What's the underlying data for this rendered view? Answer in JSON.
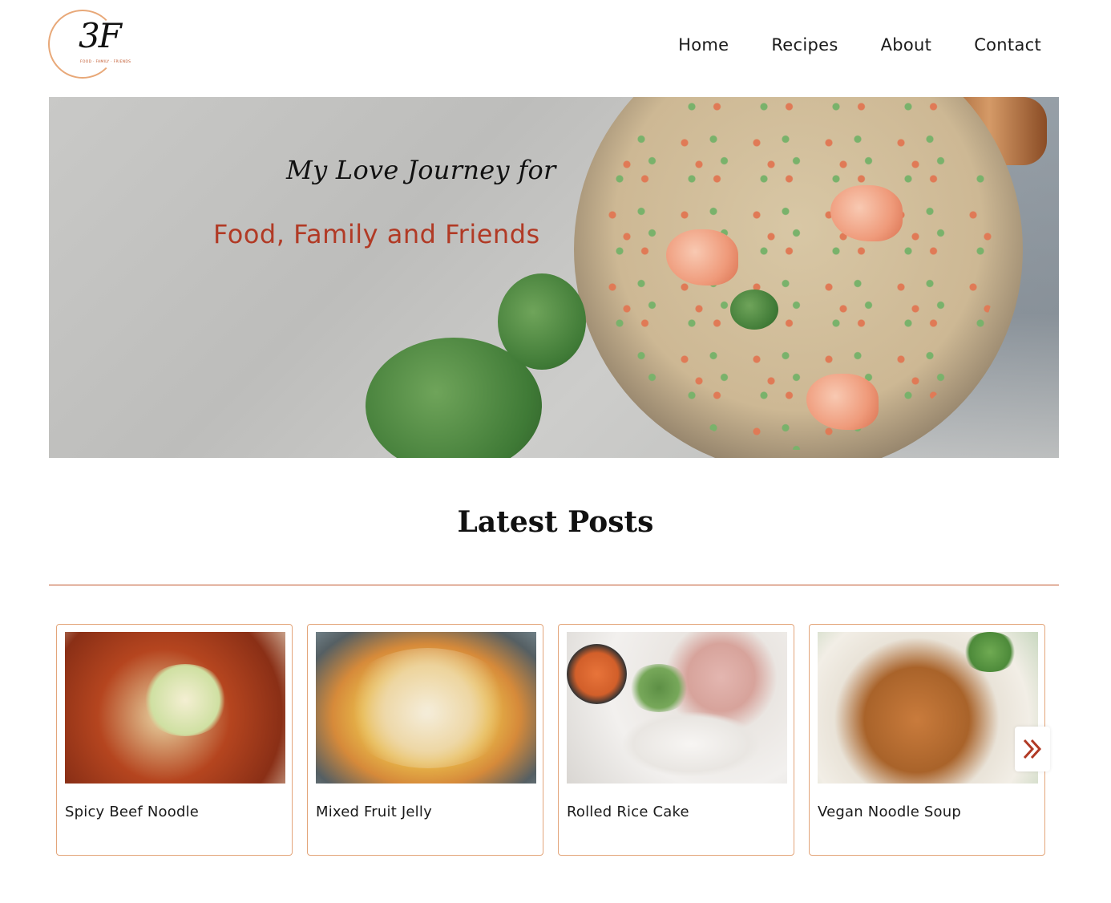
{
  "brand": {
    "logo_mark": "3F",
    "logo_tagline": "FOOD · FAMILY · FRIENDS"
  },
  "nav": {
    "items": [
      {
        "label": "Home"
      },
      {
        "label": "Recipes"
      },
      {
        "label": "About"
      },
      {
        "label": "Contact"
      }
    ]
  },
  "hero": {
    "script_line": "My Love Journey for",
    "main_line": "Food, Family and Friends"
  },
  "latest": {
    "title": "Latest Posts",
    "posts": [
      {
        "title": "Spicy Beef Noodle"
      },
      {
        "title": "Mixed Fruit Jelly"
      },
      {
        "title": "Rolled Rice Cake"
      },
      {
        "title": "Vegan Noodle Soup"
      }
    ],
    "next_icon": "double-chevron-right-icon"
  },
  "colors": {
    "accent": "#c0562b",
    "card_border": "#e3a57a",
    "hero_text": "#b13a25"
  }
}
